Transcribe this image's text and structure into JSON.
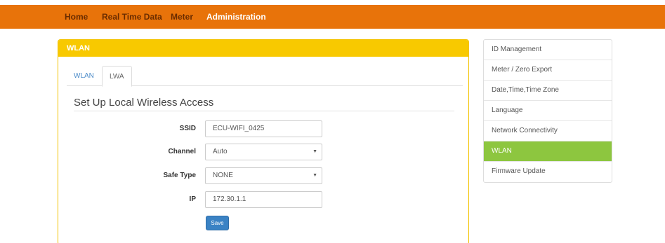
{
  "nav": {
    "items": [
      {
        "label": "Home",
        "active": false
      },
      {
        "label": "Real Time Data",
        "active": false
      },
      {
        "label": "Meter",
        "active": false
      },
      {
        "label": "Administration",
        "active": true
      }
    ]
  },
  "panel": {
    "title": "WLAN",
    "tabs": [
      {
        "label": "WLAN",
        "active": false
      },
      {
        "label": "LWA",
        "active": true
      }
    ],
    "section_title": "Set Up Local Wireless Access",
    "form": {
      "ssid_label": "SSID",
      "ssid_value": "ECU-WIFI_0425",
      "channel_label": "Channel",
      "channel_value": "Auto",
      "safe_type_label": "Safe Type",
      "safe_type_value": "NONE",
      "ip_label": "IP",
      "ip_value": "172.30.1.1",
      "save_label": "Save"
    }
  },
  "sidebar": {
    "items": [
      {
        "label": "ID Management",
        "active": false
      },
      {
        "label": "Meter / Zero Export",
        "active": false
      },
      {
        "label": "Date,Time,Time Zone",
        "active": false
      },
      {
        "label": "Language",
        "active": false
      },
      {
        "label": "Network Connectivity",
        "active": false
      },
      {
        "label": "WLAN",
        "active": true
      },
      {
        "label": "Firmware Update",
        "active": false
      }
    ]
  },
  "colors": {
    "navbar": "#e8730a",
    "panel_header": "#f8c900",
    "sidebar_active": "#8dc63f",
    "save_button": "#3a82c4"
  }
}
